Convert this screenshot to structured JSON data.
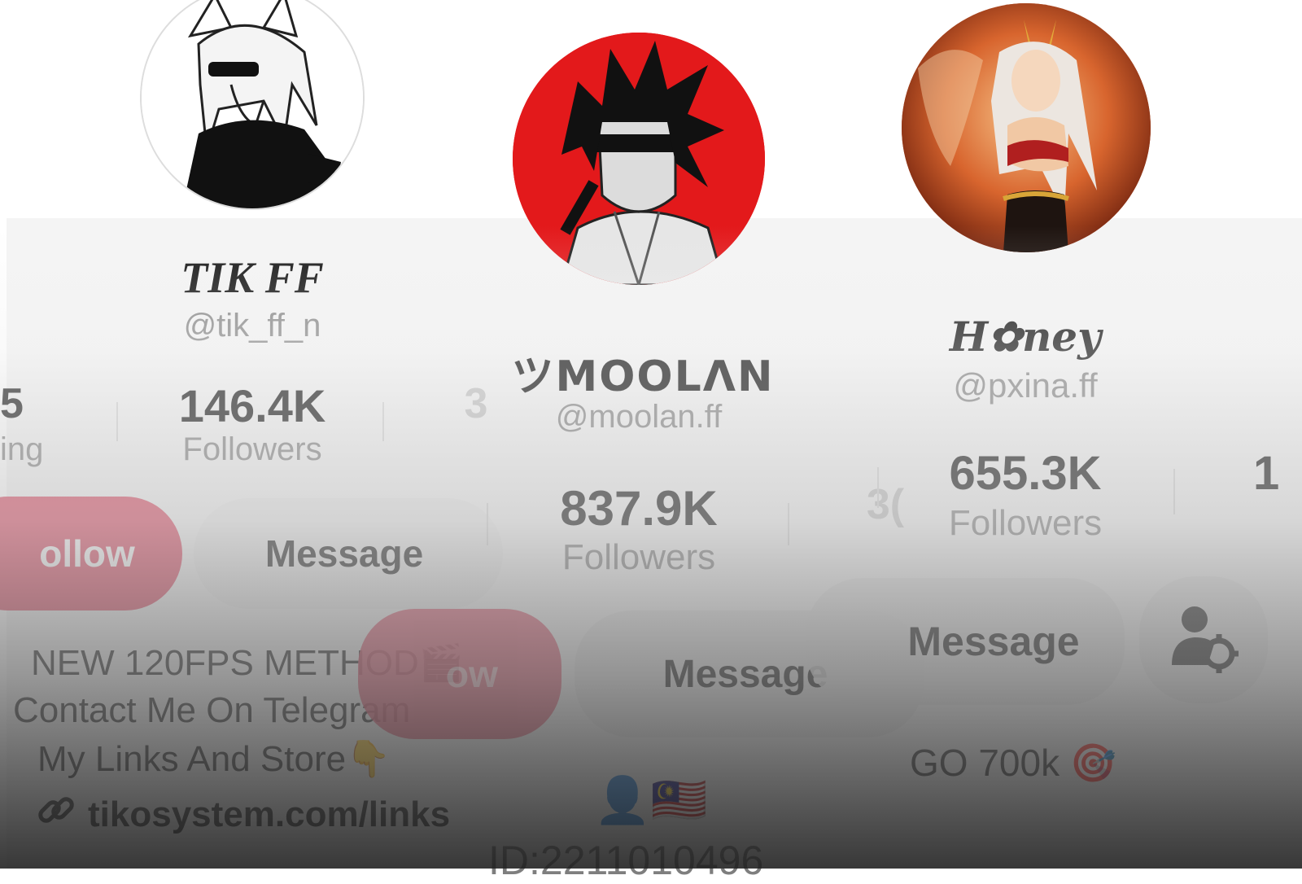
{
  "profiles": [
    {
      "display_name": "TIK FF",
      "handle": "@tik_ff_n",
      "partial_stat_value": "5",
      "partial_stat_label": "ing",
      "followers_value": "146.4K",
      "followers_label": "Followers",
      "follow_label": "ollow",
      "message_label": "Message",
      "bio_lines": [
        "NEW 120FPS METHOD🎬",
        "Contact Me On Telegram",
        "My Links And Store👇"
      ],
      "link_text": "tikosystem.com/links"
    },
    {
      "display_name": "ツMOOLΛN",
      "handle": "@moolan.ff",
      "followers_value": "837.9K",
      "followers_label": "Followers",
      "follow_label": "ow",
      "message_label": "Message",
      "bio_emoji": "👤🇲🇾",
      "bio_id": "ID:2211010496"
    },
    {
      "display_name": "H✿ney",
      "handle": "@pxina.ff",
      "followers_value": "655.3K",
      "followers_label": "Followers",
      "partial_stat_value": "1",
      "message_label": "Message",
      "bio_line": "GO 700k 🎯",
      "settings_icon": "person-gear-icon"
    }
  ],
  "ghost_glyphs": {
    "a": "3",
    "b": "3("
  },
  "colors": {
    "follow": "#e0566e",
    "avatar_red": "#e3191b",
    "message_bg": "#ececec"
  }
}
